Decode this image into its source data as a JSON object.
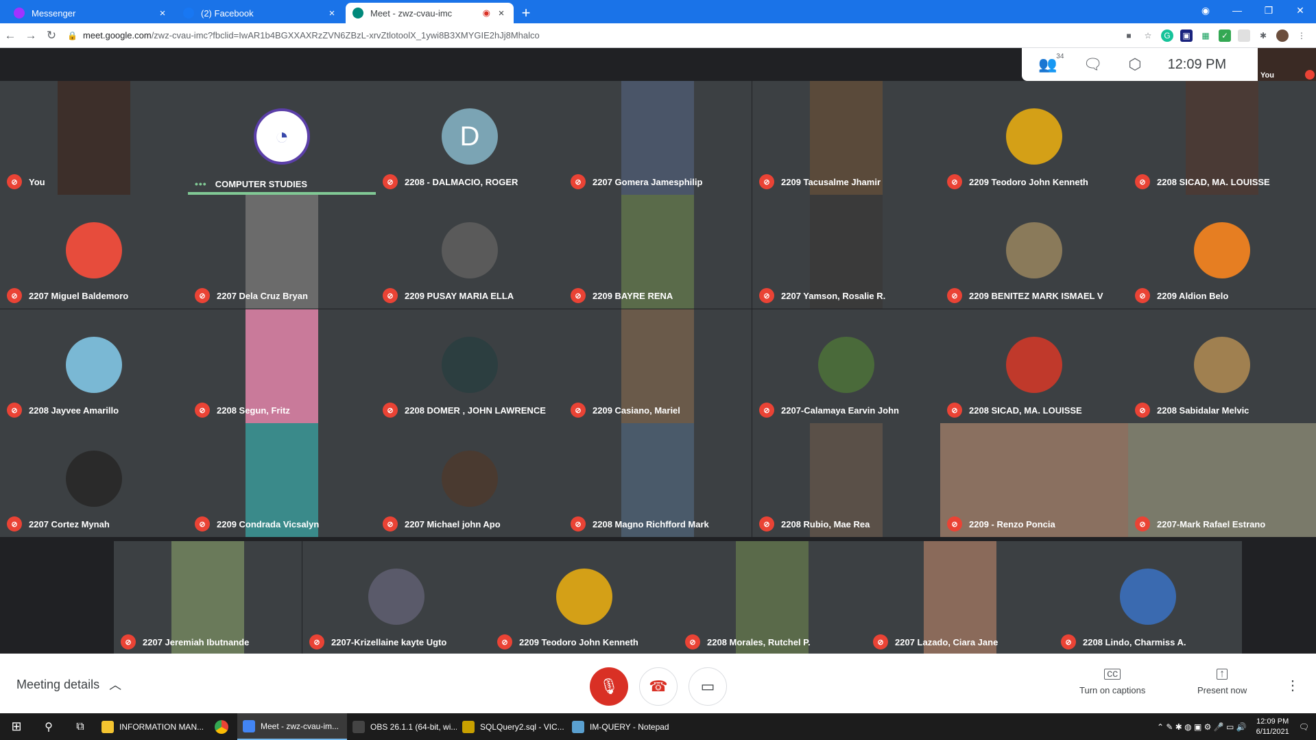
{
  "browser": {
    "tabs": [
      {
        "title": "Messenger",
        "favicon_color": "#a033ff",
        "active": false
      },
      {
        "title": "(2) Facebook",
        "favicon_color": "#1877f2",
        "active": false
      },
      {
        "title": "Meet - zwz-cvau-imc",
        "favicon_color": "#00897b",
        "active": true,
        "recording": true
      }
    ],
    "url_host": "meet.google.com",
    "url_path": "/zwz-cvau-imc?fbclid=IwAR1b4BGXXAXRzZVN6ZBzL-xrvZtlotoolX_1ywi8B3XMYGIE2hJj8Mhalco",
    "tab_color": "#1a73e8"
  },
  "meet": {
    "participant_count": "34",
    "time": "12:09 PM",
    "self_label": "You",
    "participants": [
      {
        "name": "You",
        "kind": "video",
        "bg": "#3d2f2a"
      },
      {
        "name": "COMPUTER STUDIES",
        "kind": "logo",
        "bg": "#3c4043",
        "speaking": true
      },
      {
        "name": "2208 - DALMACIO, ROGER",
        "kind": "initial",
        "initial": "D",
        "bg": "#3c4043",
        "avatar": "#7ba4b4"
      },
      {
        "name": "2207 Gomera Jamesphilip",
        "kind": "video",
        "bg": "#4a5568"
      },
      {
        "name": "2209 Tacusalme Jhamir",
        "kind": "video",
        "bg": "#5a4a3a"
      },
      {
        "name": "2209 Teodoro John Kenneth",
        "kind": "avatar",
        "bg": "#3c4043",
        "avatar": "#d4a017"
      },
      {
        "name": "2208 SICAD, MA. LOUISSE",
        "kind": "video",
        "bg": "#4a3a35"
      },
      {
        "name": "2207 Miguel Baldemoro",
        "kind": "avatar",
        "bg": "#3c4043",
        "avatar": "#e74c3c"
      },
      {
        "name": "2207 Dela Cruz Bryan",
        "kind": "video",
        "bg": "#6b6b6b"
      },
      {
        "name": "2209 PUSAY MARIA ELLA",
        "kind": "avatar",
        "bg": "#3c4043",
        "avatar": "#5a5a5a"
      },
      {
        "name": "2209 BAYRE RENA",
        "kind": "video",
        "bg": "#5a6b4a"
      },
      {
        "name": "2207 Yamson, Rosalie R.",
        "kind": "video",
        "bg": "#3a3a3a"
      },
      {
        "name": "2209 BENITEZ MARK ISMAEL V",
        "kind": "avatar",
        "bg": "#3c4043",
        "avatar": "#8a7a5a"
      },
      {
        "name": "2209 Aldion Belo",
        "kind": "avatar",
        "bg": "#3c4043",
        "avatar": "#e67e22"
      },
      {
        "name": "2208 Jayvee Amarillo",
        "kind": "avatar",
        "bg": "#3c4043",
        "avatar": "#7ab8d4"
      },
      {
        "name": "2208 Segun, Fritz",
        "kind": "video",
        "bg": "#c97a9a"
      },
      {
        "name": "2208 DOMER , JOHN LAWRENCE",
        "kind": "avatar",
        "bg": "#3c4043",
        "avatar": "#2c3e40"
      },
      {
        "name": "2209 Casiano, Mariel",
        "kind": "video",
        "bg": "#6a5a4a"
      },
      {
        "name": "2207-Calamaya Earvin John",
        "kind": "avatar",
        "bg": "#3c4043",
        "avatar": "#4a6a3a"
      },
      {
        "name": "2208 SICAD, MA. LOUISSE",
        "kind": "avatar",
        "bg": "#3c4043",
        "avatar": "#c0392b"
      },
      {
        "name": "2208 Sabidalar Melvic",
        "kind": "avatar",
        "bg": "#3c4043",
        "avatar": "#a08050"
      },
      {
        "name": "2207 Cortez Mynah",
        "kind": "avatar",
        "bg": "#3c4043",
        "avatar": "#2a2a2a"
      },
      {
        "name": "2209 Condrada Vicsalyn",
        "kind": "video",
        "bg": "#3a8a8a"
      },
      {
        "name": "2207 Michael john Apo",
        "kind": "avatar",
        "bg": "#3c4043",
        "avatar": "#4a3a30"
      },
      {
        "name": "2208 Magno Richfford Mark",
        "kind": "video",
        "bg": "#4a5a6a"
      },
      {
        "name": "2208 Rubio, Mae Rea",
        "kind": "video",
        "bg": "#5a5048"
      },
      {
        "name": "2209 - Renzo Poncia",
        "kind": "wide",
        "bg": "#8a7060"
      },
      {
        "name": "2207-Mark Rafael Estrano",
        "kind": "wide",
        "bg": "#7a7a6a"
      },
      {
        "name": "2207 Jeremiah Ibutnande",
        "kind": "video",
        "bg": "#6a7a5a"
      },
      {
        "name": "2207-Krizellaine kayte Ugto",
        "kind": "avatar",
        "bg": "#3c4043",
        "avatar": "#5a5a6a"
      },
      {
        "name": "2209 Teodoro John Kenneth",
        "kind": "avatar",
        "bg": "#3c4043",
        "avatar": "#d4a017"
      },
      {
        "name": "2208 Morales, Rutchel P.",
        "kind": "video",
        "bg": "#5a6a4a"
      },
      {
        "name": "2207 Lazado, Ciara Jane",
        "kind": "video",
        "bg": "#8a6a5a"
      },
      {
        "name": "2208 Lindo, Charmiss A.",
        "kind": "avatar",
        "bg": "#3c4043",
        "avatar": "#3a6ab0"
      }
    ]
  },
  "controls": {
    "meeting_details": "Meeting details",
    "captions": "Turn on captions",
    "present": "Present now"
  },
  "taskbar": {
    "items": [
      {
        "label": "INFORMATION MAN...",
        "color": "#f4c430"
      },
      {
        "label": "Meet - zwz-cvau-im...",
        "color": "#4285f4",
        "active": true
      },
      {
        "label": "OBS 26.1.1 (64-bit, wi...",
        "color": "#444"
      },
      {
        "label": "SQLQuery2.sql - VIC...",
        "color": "#c8a000"
      },
      {
        "label": "IM-QUERY - Notepad",
        "color": "#5aa0d0"
      }
    ],
    "time": "12:09 PM",
    "date": "6/11/2021"
  }
}
